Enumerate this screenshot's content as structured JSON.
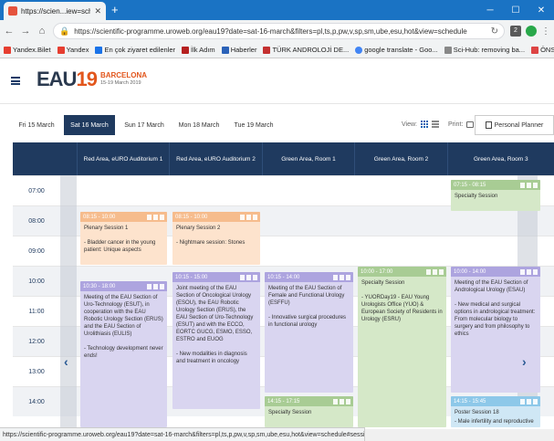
{
  "browser": {
    "tab_title": "https://scien...iew=schedule",
    "url": "https://scientific-programme.uroweb.org/eau19?date=sat-16-march&filters=pl,ts,p,pw,v,sp,sm,ube,esu,hot&view=schedule",
    "ext_badge": "2",
    "bookmarks": [
      "Yandex.Bilet",
      "Yandex",
      "En çok ziyaret edilenler",
      "İlk Adım",
      "Haberler",
      "TÜRK ANDROLOJİ DE...",
      "google translate - Goo...",
      "Sci-Hub: removing ba...",
      "ÖNSÖZ - 747.pdf"
    ],
    "status_url": "https://scientific-programme.uroweb.org/eau19?date=sat-16-march&filters=pl,ts,p,pw,v,sp,sm,ube,esu,hot&view=schedule#session-13717"
  },
  "site": {
    "logo_main": "EAU",
    "logo_num": "19",
    "logo_city": "BARCELONA",
    "logo_dates": "15-19 March 2019"
  },
  "days": [
    "Fri 15 March",
    "Sat 16 March",
    "Sun 17 March",
    "Mon 18 March",
    "Tue 19 March"
  ],
  "view_label": "View:",
  "print_label": "Print:",
  "planner_label": "Personal Planner",
  "columns": [
    "Red Area, eURO Auditorium 1",
    "Red Area, eURO Auditorium 2",
    "Green Area, Room 1",
    "Green Area, Room 2",
    "Green Area, Room 3"
  ],
  "times": [
    "07:00",
    "08:00",
    "09:00",
    "10:00",
    "11:00",
    "12:00",
    "13:00",
    "14:00"
  ],
  "events": {
    "e1": {
      "time": "08:15 - 10:00",
      "title": "Plenary Session 1",
      "desc": "- Bladder cancer in the young patient: Unique aspects"
    },
    "e2": {
      "time": "08:15 - 10:00",
      "title": "Plenary Session 2",
      "desc": "- Nightmare session: Stones"
    },
    "e3": {
      "time": "10:30 - 18:00",
      "title": "Meeting of the EAU Section of Uro-Technology (ESUT), in cooperation with the EAU Robotic Urology Section (ERUS) and the EAU Section of Urolithiasis (EULIS)",
      "desc": "- Technology development never ends!"
    },
    "e4": {
      "time": "10:15 - 15:00",
      "title": "Joint meeting of the EAU Section of Oncological Urology (ESOU), the EAU Robotic Urology Section (ERUS), the EAU Section of Uro-Technology (ESUT) and with the ECCO, EORTC GUCG, ESMO, ESSO, ESTRO and EUOG",
      "desc": "- New modalities in diagnosis and treatment in oncology"
    },
    "e5": {
      "time": "10:15 - 14:00",
      "title": "Meeting of the EAU Section of Female and Functional Urology (ESFFU)",
      "desc": "- Innovative surgical procedures in functional urology"
    },
    "e6": {
      "time": "10:00 - 17:00",
      "title": "Specialty Session",
      "desc": "- YUORDay19 - EAU Young Urologists Office (YUO) & European Society of Residents in Urology (ESRU)"
    },
    "e7": {
      "time": "10:00 - 14:00",
      "title": "Meeting of the EAU Section of Andrological Urology (ESAU)",
      "desc": "- New medical and surgical options in andrological treatment: From molecular biology to surgery and from philosophy to ethics"
    },
    "e8": {
      "time": "07:15 - 08:15",
      "title": "Specialty Session",
      "desc": ""
    },
    "e9": {
      "time": "14:15 - 17:15",
      "title": "Specialty Session",
      "desc": ""
    },
    "e10": {
      "time": "14:15 - 15:45",
      "title": "Poster Session 18",
      "desc": "- Male infertility and reproductive"
    }
  }
}
